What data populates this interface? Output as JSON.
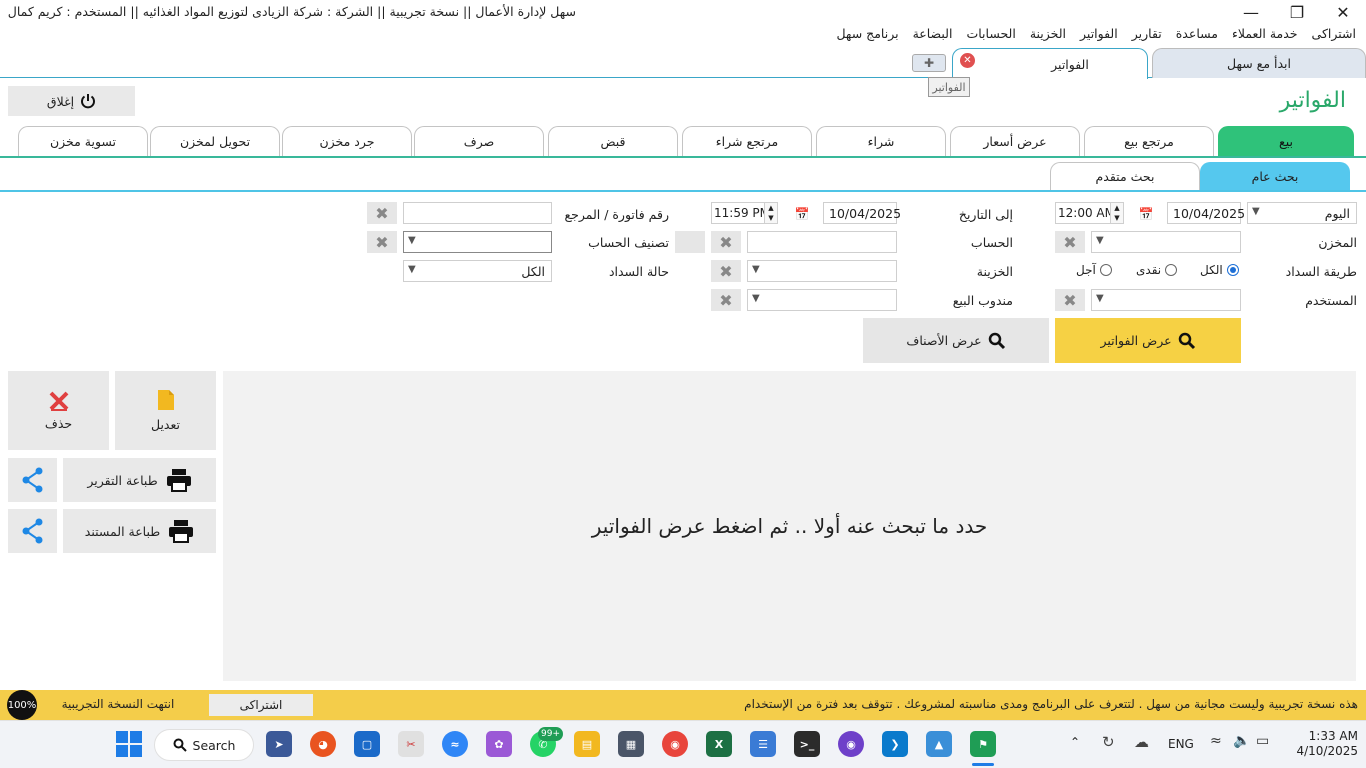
{
  "window": {
    "title": "سهل لإدارة الأعمال  ||  نسخة تجريبية  ||  الشركة : شركة الزيادى لتوزيع المواد الغذائيه  ||  المستخدم : كريم كمال",
    "minimize_icon": "minimize-icon",
    "maximize_icon": "restore-icon",
    "close_icon": "close-icon"
  },
  "menu": [
    "برنامج سهل",
    "البضاعة",
    "الحسابات",
    "الخزينة",
    "الفواتير",
    "تقارير",
    "مساعدة",
    "خدمة العملاء",
    "اشتراكى"
  ],
  "doc_tabs": {
    "home": "ابدأ مع سهل",
    "invoices": "الفواتير",
    "tooltip": "الفواتير"
  },
  "page": {
    "title": "الفواتير",
    "close_label": "إغلاق"
  },
  "op_tabs": [
    "بيع",
    "مرتجع بيع",
    "عرض أسعار",
    "شراء",
    "مرتجع شراء",
    "قبض",
    "صرف",
    "جرد مخزن",
    "تحويل لمخزن",
    "تسوية مخزن"
  ],
  "search_tabs": {
    "general": "بحث عام",
    "advanced": "بحث متقدم"
  },
  "filters": {
    "period": "اليوم",
    "from_date": "10/04/2025",
    "from_time": "12:00 AM",
    "to_label": "إلى التاريخ",
    "to_date": "10/04/2025",
    "to_time": "11:59 PM",
    "invoice_ref_label": "رقم فاتورة / المرجع",
    "store_label": "المخزن",
    "account_label": "الحساب",
    "account_class_label": "تصنيف الحساب",
    "payment_method_label": "طريقة السداد",
    "payment_all": "الكل",
    "payment_cash": "نقدى",
    "payment_credit": "آجل",
    "treasury_label": "الخزينة",
    "payment_status_label": "حالة السداد",
    "payment_status_value": "الكل",
    "user_label": "المستخدم",
    "sales_rep_label": "مندوب البيع"
  },
  "actions": {
    "show_invoices": "عرض الفواتير",
    "show_items": "عرض الأصناف",
    "edit": "تعديل",
    "delete": "حذف",
    "print_report": "طباعة التقرير",
    "print_document": "طباعة المستند"
  },
  "results": {
    "empty_message": "حدد ما تبحث عنه أولا .. ثم اضغط عرض الفواتير"
  },
  "status": {
    "message": "هذه نسخة تجريبية وليست مجانية من سهل . لتتعرف على البرنامج ومدى مناسبته لمشروعك . تتوقف بعد فترة من الإستخدام",
    "subscribe": "اشتراكى",
    "trial_ended": "انتهت النسخة التجريبية",
    "progress": "100%"
  },
  "taskbar": {
    "search": "Search",
    "whatsapp_badge": "99+",
    "lang": "ENG",
    "time": "1:33 AM",
    "date": "4/10/2025"
  },
  "colors": {
    "accent_green": "#2fc27a",
    "accent_blue": "#55c8ee",
    "yellow": "#f6d144",
    "title_green": "#2aa86a"
  }
}
